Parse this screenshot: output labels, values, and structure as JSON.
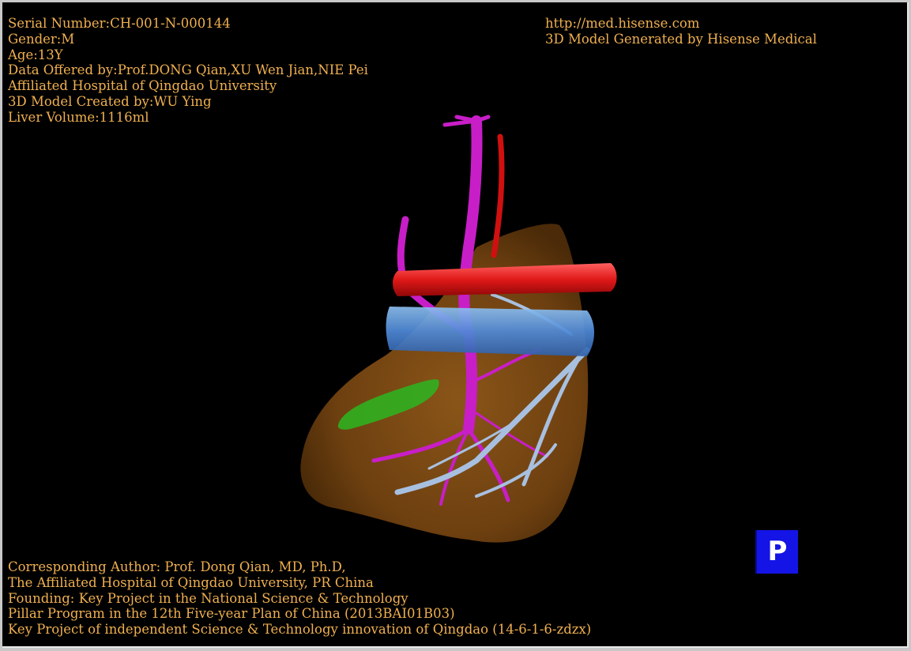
{
  "header_left": [
    "Serial Number:CH-001-N-000144",
    "Gender:M",
    "Age:13Y",
    "Data Offered by:Prof.DONG Qian,XU Wen Jian,NIE Pei",
    "Affiliated Hospital of Qingdao University",
    "3D Model Created by:WU Ying",
    "Liver Volume:1116ml"
  ],
  "header_right": [
    "http://med.hisense.com",
    "3D Model Generated by Hisense Medical"
  ],
  "footer": [
    "Corresponding Author: Prof. Dong Qian, MD, Ph.D,",
    "The Affiliated Hospital of Qingdao University, PR China",
    "Founding: Key Project in the National Science & Technology",
    "Pillar Program in the 12th Five-year Plan of China (2013BAI01B03)",
    "Key Project of independent Science & Technology innovation of Qingdao (14-6-1-6-zdzx)"
  ],
  "orientation_cube": {
    "label": "P"
  },
  "colors": {
    "text": "#f0b050",
    "liver": "#7a4a12",
    "portal_vein": "#c81ec8",
    "artery": "#e01818",
    "ivc": "#5a9ae0",
    "hepatic_vein": "#a8c0e0",
    "gallbladder": "#30b020"
  }
}
